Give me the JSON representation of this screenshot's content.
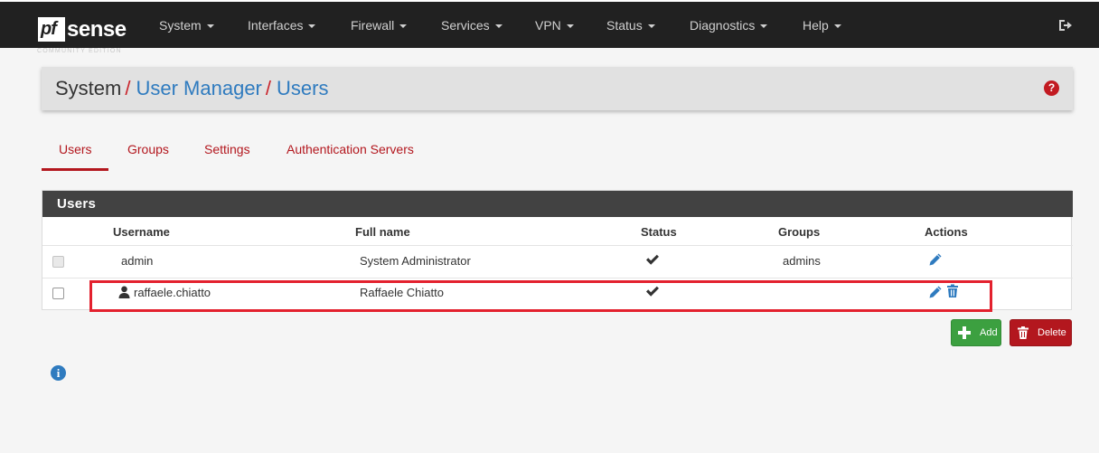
{
  "brand": {
    "logo_pf": "pf",
    "logo_sense": "sense",
    "edition": "COMMUNITY EDITION"
  },
  "nav": {
    "items": [
      {
        "label": "System"
      },
      {
        "label": "Interfaces"
      },
      {
        "label": "Firewall"
      },
      {
        "label": "Services"
      },
      {
        "label": "VPN"
      },
      {
        "label": "Status"
      },
      {
        "label": "Diagnostics"
      },
      {
        "label": "Help"
      }
    ],
    "logout_icon": "sign-out-icon"
  },
  "breadcrumb": {
    "root": "System",
    "sep": "/",
    "links": [
      "User Manager",
      "Users"
    ],
    "help_icon": "question-circle-icon",
    "help_text": "?"
  },
  "tabs": [
    {
      "label": "Users",
      "active": true
    },
    {
      "label": "Groups"
    },
    {
      "label": "Settings"
    },
    {
      "label": "Authentication Servers"
    }
  ],
  "users_panel": {
    "title": "Users",
    "columns": [
      "Username",
      "Full name",
      "Status",
      "Groups",
      "Actions"
    ],
    "rows": [
      {
        "username": "admin",
        "full_name": "System Administrator",
        "status": "enabled",
        "groups": "admins",
        "actions": [
          "edit"
        ],
        "checkbox_disabled": true
      },
      {
        "username": "raffaele.chiatto",
        "full_name": "Raffaele Chiatto",
        "status": "enabled",
        "groups": "",
        "actions": [
          "edit",
          "delete"
        ],
        "checkbox_disabled": false,
        "user_icon": "user-icon"
      }
    ]
  },
  "buttons": {
    "add": "Add",
    "delete": "Delete"
  },
  "info_icon": "i",
  "colors": {
    "accent_red": "#b3171e",
    "link_blue": "#2f7bbf",
    "add_green": "#3ca040",
    "navbar": "#212121",
    "highlight": "#e3212e"
  }
}
